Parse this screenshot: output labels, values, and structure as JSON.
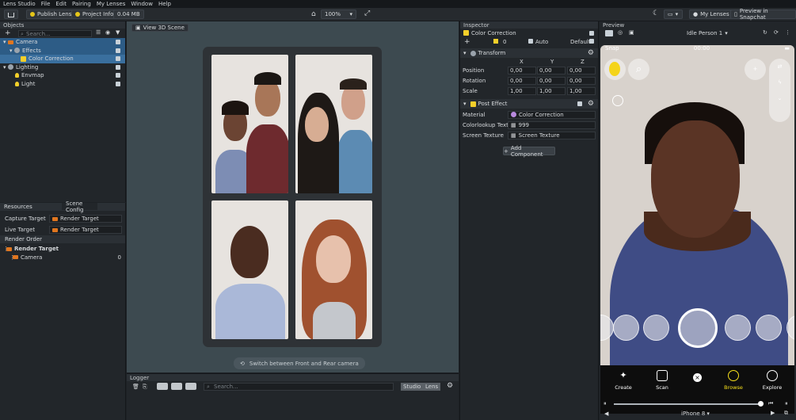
{
  "menubar": {
    "items": [
      "Lens Studio",
      "File",
      "Edit",
      "Pairing",
      "My Lenses",
      "Window",
      "Help"
    ]
  },
  "toolbar": {
    "publish": "Publish Lens",
    "project_info": "Project Info",
    "size": "0.04 MB",
    "zoom": "100%",
    "my_lenses": "My Lenses",
    "preview_snapchat": "Preview in Snapchat"
  },
  "objects": {
    "title": "Objects",
    "search_placeholder": "Search...",
    "items": [
      {
        "label": "Camera",
        "depth": 0,
        "icon": "camera-icon",
        "selected": true
      },
      {
        "label": "Effects",
        "depth": 1,
        "icon": "effects-icon",
        "selected": true
      },
      {
        "label": "Color Correction",
        "depth": 2,
        "icon": "color-correction-icon",
        "selected": true
      },
      {
        "label": "Lighting",
        "depth": 0,
        "icon": "lighting-icon",
        "selected": false
      },
      {
        "label": "Envmap",
        "depth": 1,
        "icon": "bulb-icon",
        "selected": false
      },
      {
        "label": "Light",
        "depth": 1,
        "icon": "bulb-icon",
        "selected": false
      }
    ]
  },
  "resources": {
    "tab1": "Resources",
    "tab2": "Scene Config",
    "capture_label": "Capture Target",
    "capture_value": "Render Target",
    "live_label": "Live Target",
    "live_value": "Render Target",
    "render_order": "Render Order",
    "rt": "Render Target",
    "camera": "Camera",
    "camera_order": "0"
  },
  "scene": {
    "view_label": "View 3D Scene",
    "switch_label": "Switch between Front and Rear camera"
  },
  "logger": {
    "title": "Logger",
    "search_placeholder": "Search...",
    "studio": "Studio",
    "lens": "Lens"
  },
  "inspector": {
    "title": "Inspector",
    "object_name": "Color Correction",
    "layer": "0",
    "auto": "Auto",
    "default": "Default",
    "transform": {
      "title": "Transform",
      "x": "X",
      "y": "Y",
      "z": "Z",
      "rows": [
        {
          "label": "Position",
          "v": [
            "0,00",
            "0,00",
            "0,00"
          ]
        },
        {
          "label": "Rotation",
          "v": [
            "0,00",
            "0,00",
            "0,00"
          ]
        },
        {
          "label": "Scale",
          "v": [
            "1,00",
            "1,00",
            "1,00"
          ]
        }
      ]
    },
    "post_effect": {
      "title": "Post Effect",
      "material_label": "Material",
      "material": "Color Correction",
      "lookup_label": "Colorlookup Text...",
      "lookup": "999",
      "screen_label": "Screen Texture",
      "screen": "Screen Texture"
    },
    "add_component": "Add Component"
  },
  "preview": {
    "title": "Preview",
    "person": "Idle Person 1",
    "snap": "Snap",
    "time": "00:00",
    "device": "iPhone 8",
    "nav": [
      {
        "label": "Create",
        "active": false
      },
      {
        "label": "Scan",
        "active": false
      },
      {
        "label": "Browse",
        "active": true
      },
      {
        "label": "Explore",
        "active": false
      }
    ]
  },
  "colors": {
    "accent": "#2d5c86",
    "snap_yellow": "#fffc00",
    "browse_yellow": "#f7e01b"
  }
}
